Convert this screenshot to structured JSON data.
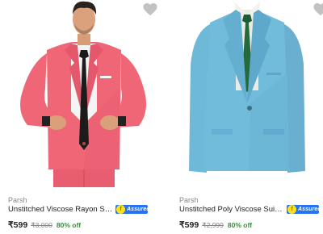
{
  "products": [
    {
      "brand": "Parsh",
      "title": "Unstitched Viscose Rayon Suit Fa...",
      "assured_label": "Assured",
      "price": "₹599",
      "mrp": "₹3,000",
      "discount": "80% off",
      "suit_color": "#ef6777",
      "icons": [
        "heart-icon",
        "assured-badge-icon"
      ]
    },
    {
      "brand": "Parsh",
      "title": "Unstitched Poly Viscose Suit Fabri...",
      "assured_label": "Assured",
      "price": "₹599",
      "mrp": "₹2,999",
      "discount": "80% off",
      "suit_color": "#6fb9d8",
      "icons": [
        "heart-icon",
        "assured-badge-icon"
      ]
    }
  ],
  "colors": {
    "accent": "#2874f0",
    "discount": "#388e3c",
    "muted": "#878787",
    "assured_mark": "#ffe11b"
  }
}
